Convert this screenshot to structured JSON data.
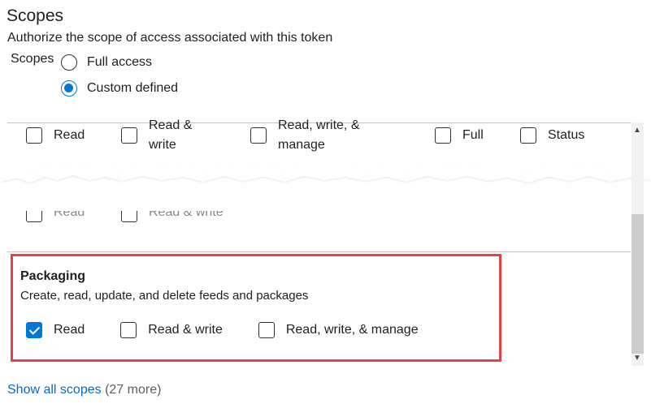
{
  "section": {
    "title": "Scopes",
    "subtitle": "Authorize the scope of access associated with this token",
    "scopes_label": "Scopes"
  },
  "radios": [
    {
      "label": "Full access",
      "checked": false
    },
    {
      "label": "Custom defined",
      "checked": true
    }
  ],
  "top_row": {
    "options": [
      {
        "label": "Read",
        "checked": false
      },
      {
        "label": "Read & write",
        "line1": "Read &",
        "line2": "write",
        "checked": false
      },
      {
        "label": "Read, write, & manage",
        "line1": "Read, write, &",
        "line2": "manage",
        "checked": false
      },
      {
        "label": "Full",
        "checked": false
      },
      {
        "label": "Status",
        "checked": false
      }
    ]
  },
  "partial_row": {
    "options": [
      {
        "label": "Read"
      },
      {
        "label": "Read & write"
      }
    ]
  },
  "packaging": {
    "title": "Packaging",
    "description": "Create, read, update, and delete feeds and packages",
    "options": [
      {
        "label": "Read",
        "checked": true
      },
      {
        "label": "Read & write",
        "checked": false
      },
      {
        "label": "Read, write, & manage",
        "checked": false
      }
    ]
  },
  "footer": {
    "show_all_label": "Show all scopes",
    "more_count": "(27 more)"
  },
  "colors": {
    "accent": "#0078d4",
    "highlight_border": "#e0444a",
    "link": "#0b6ac6"
  }
}
